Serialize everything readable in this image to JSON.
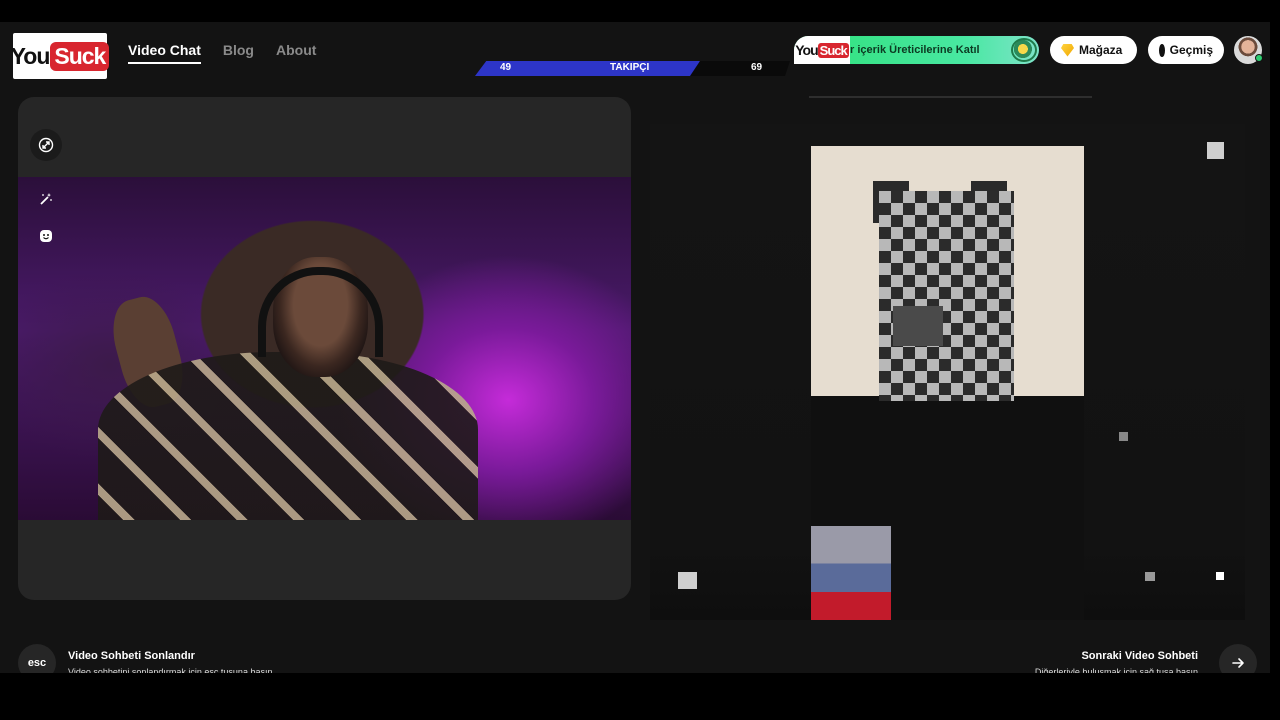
{
  "header": {
    "logo": {
      "part1": "You",
      "part2": "Suck"
    },
    "nav": [
      {
        "label": "Video Chat",
        "active": true
      },
      {
        "label": "Blog",
        "active": false
      },
      {
        "label": "About",
        "active": false
      }
    ],
    "followers": {
      "left": "49",
      "label": "TAKIPÇI",
      "right": "69"
    },
    "creator_banner": {
      "text": "r içerik Üreticilerine Katıl",
      "logo_part1": "You",
      "logo_part2": "Suck"
    },
    "store_label": "Mağaza",
    "history_label": "Geçmiş"
  },
  "icons": {
    "expand": "expand-icon",
    "magic": "magic-wand-icon",
    "emoji": "emoji-icon",
    "store": "gem-icon",
    "history": "clock-icon",
    "next": "arrow-right-icon"
  },
  "footer": {
    "end": {
      "key": "esc",
      "title": "Video Sohbeti Sonlandır",
      "subtitle": "Video sohbetini sonlandırmak için esc tuşuna basın."
    },
    "next": {
      "title": "Sonraki Video Sohbeti",
      "subtitle": "Diğerleriyle buluşmak için sağ tuşa basın"
    }
  },
  "colors": {
    "background": "#131313",
    "panel": "#262626",
    "follow_bar": "#2d35c8",
    "banner_green": "#2fe07a",
    "logo_red": "#d8262f"
  }
}
